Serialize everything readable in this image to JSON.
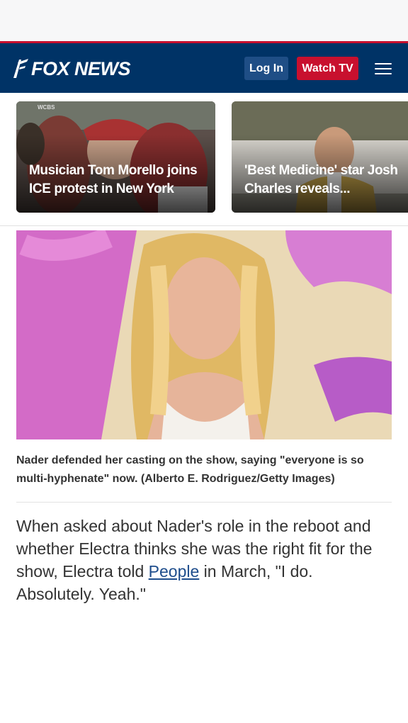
{
  "header": {
    "logo_text": "FOX NEWS",
    "login_label": "Log In",
    "watch_label": "Watch TV",
    "menu_icon": "hamburger-menu-icon",
    "colors": {
      "navy": "#003366",
      "red": "#c8102e",
      "login_bg": "#1f4e86"
    }
  },
  "cards": [
    {
      "title": "Musician Tom Morello joins ICE protest in New York",
      "tag": "WCBS"
    },
    {
      "title": "'Best Medicine' star Josh Charles reveals...",
      "tag": ""
    }
  ],
  "article": {
    "image_alt_icon": "portrait-photo",
    "caption": "Nader defended her casting on the show, saying \"everyone is so multi-hyphenate\" now. (Alberto E. Rodriguez/Getty Images)",
    "paragraph_before": "When asked about Nader's role in the reboot and whether Electra thinks she was the right fit for the show, Electra told ",
    "link_text": "People",
    "paragraph_after": " in March, \"I do. Absolutely. Yeah.\""
  }
}
